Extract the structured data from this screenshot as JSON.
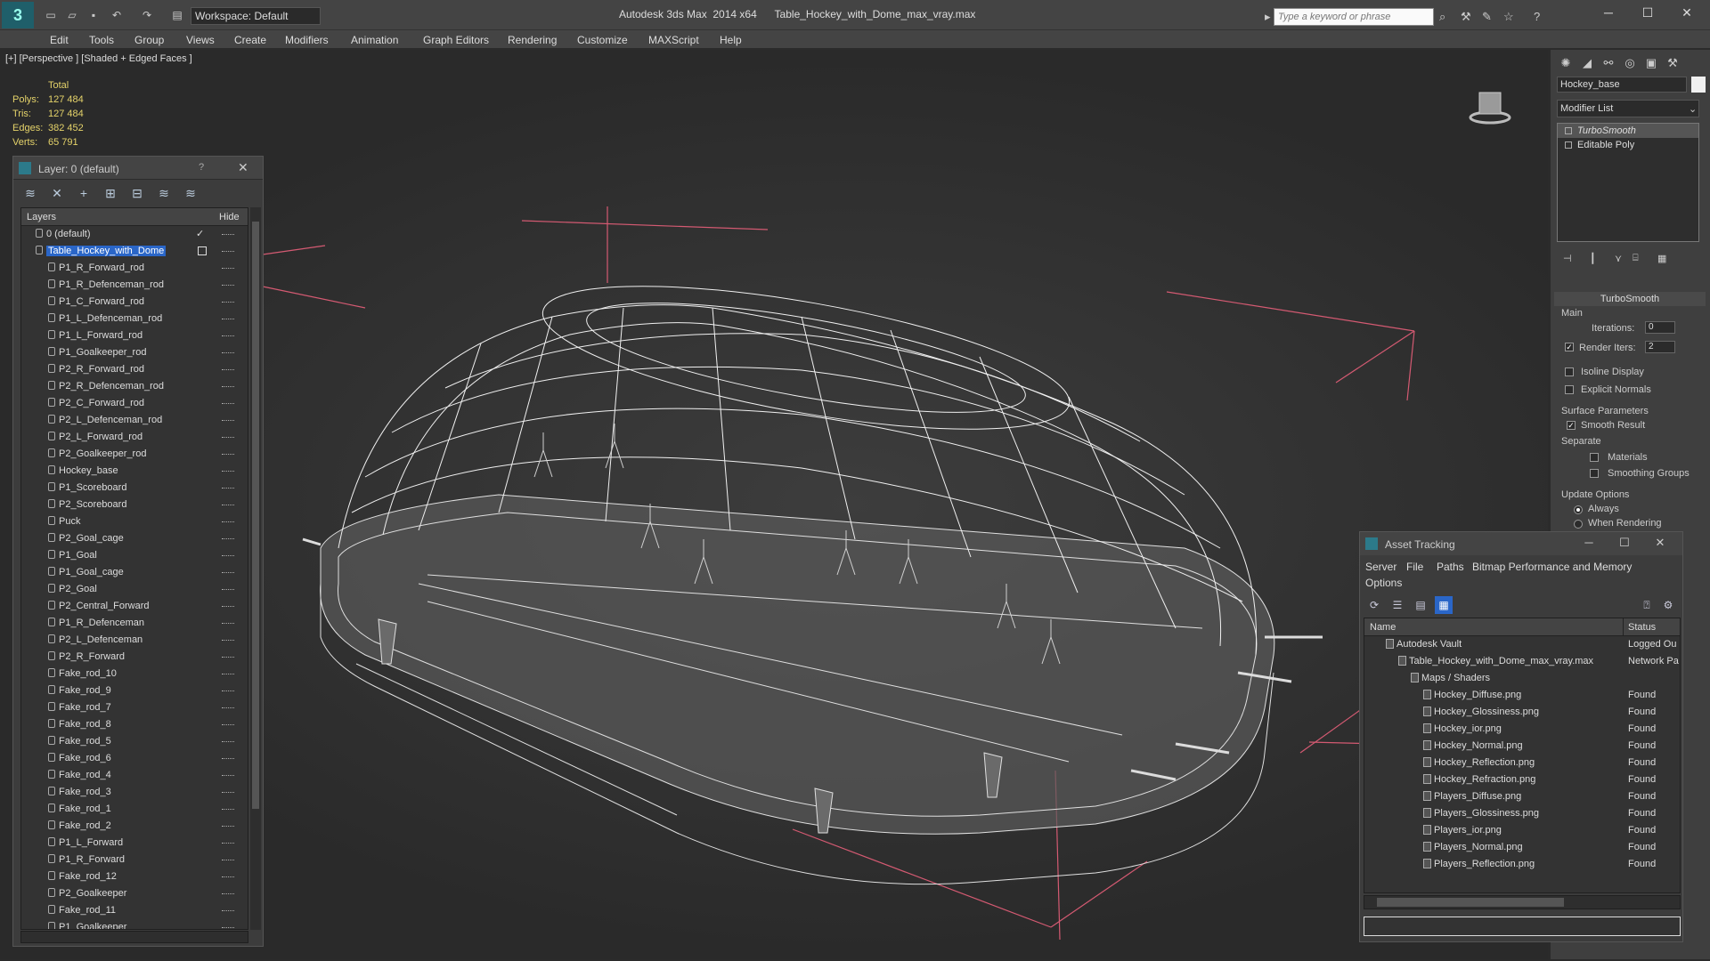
{
  "app": {
    "title": "Autodesk 3ds Max  2014 x64      Table_Hockey_with_Dome_max_vray.max",
    "logo": "3ds-max-logo",
    "workspace": "Workspace: Default",
    "search_placeholder": "Type a keyword or phrase"
  },
  "menu": [
    "Edit",
    "Tools",
    "Group",
    "Views",
    "Create",
    "Modifiers",
    "Animation",
    "Graph Editors",
    "Rendering",
    "Customize",
    "MAXScript",
    "Help"
  ],
  "viewport": {
    "label": "[+] [Perspective ] [Shaded + Edged Faces ]",
    "stats": {
      "header": "Total",
      "rows": [
        {
          "label": "Polys:",
          "value": "127 484"
        },
        {
          "label": "Tris:",
          "value": "127 484"
        },
        {
          "label": "Edges:",
          "value": "382 452"
        },
        {
          "label": "Verts:",
          "value": "65 791"
        }
      ]
    }
  },
  "layer_panel": {
    "title": "Layer: 0 (default)",
    "help": "?",
    "col_layers": "Layers",
    "col_hide": "Hide",
    "items": [
      {
        "name": "0 (default)",
        "level": 0,
        "selected": false
      },
      {
        "name": "Table_Hockey_with_Dome",
        "level": 0,
        "selected": true
      },
      {
        "name": "P1_R_Forward_rod",
        "level": 1
      },
      {
        "name": "P1_R_Defenceman_rod",
        "level": 1
      },
      {
        "name": "P1_C_Forward_rod",
        "level": 1
      },
      {
        "name": "P1_L_Defenceman_rod",
        "level": 1
      },
      {
        "name": "P1_L_Forward_rod",
        "level": 1
      },
      {
        "name": "P1_Goalkeeper_rod",
        "level": 1
      },
      {
        "name": "P2_R_Forward_rod",
        "level": 1
      },
      {
        "name": "P2_R_Defenceman_rod",
        "level": 1
      },
      {
        "name": "P2_C_Forward_rod",
        "level": 1
      },
      {
        "name": "P2_L_Defenceman_rod",
        "level": 1
      },
      {
        "name": "P2_L_Forward_rod",
        "level": 1
      },
      {
        "name": "P2_Goalkeeper_rod",
        "level": 1
      },
      {
        "name": "Hockey_base",
        "level": 1
      },
      {
        "name": "P1_Scoreboard",
        "level": 1
      },
      {
        "name": "P2_Scoreboard",
        "level": 1
      },
      {
        "name": "Puck",
        "level": 1
      },
      {
        "name": "P2_Goal_cage",
        "level": 1
      },
      {
        "name": "P1_Goal",
        "level": 1
      },
      {
        "name": "P1_Goal_cage",
        "level": 1
      },
      {
        "name": "P2_Goal",
        "level": 1
      },
      {
        "name": "P2_Central_Forward",
        "level": 1
      },
      {
        "name": "P1_R_Defenceman",
        "level": 1
      },
      {
        "name": "P2_L_Defenceman",
        "level": 1
      },
      {
        "name": "P2_R_Forward",
        "level": 1
      },
      {
        "name": "Fake_rod_10",
        "level": 1
      },
      {
        "name": "Fake_rod_9",
        "level": 1
      },
      {
        "name": "Fake_rod_7",
        "level": 1
      },
      {
        "name": "Fake_rod_8",
        "level": 1
      },
      {
        "name": "Fake_rod_5",
        "level": 1
      },
      {
        "name": "Fake_rod_6",
        "level": 1
      },
      {
        "name": "Fake_rod_4",
        "level": 1
      },
      {
        "name": "Fake_rod_3",
        "level": 1
      },
      {
        "name": "Fake_rod_1",
        "level": 1
      },
      {
        "name": "Fake_rod_2",
        "level": 1
      },
      {
        "name": "P1_L_Forward",
        "level": 1
      },
      {
        "name": "P1_R_Forward",
        "level": 1
      },
      {
        "name": "Fake_rod_12",
        "level": 1
      },
      {
        "name": "P2_Goalkeeper",
        "level": 1
      },
      {
        "name": "Fake_rod_11",
        "level": 1
      },
      {
        "name": "P1_Goalkeeper",
        "level": 1
      }
    ]
  },
  "command_panel": {
    "object_name": "Hockey_base",
    "modifier_list": "Modifier List",
    "stack": [
      {
        "name": "TurboSmooth",
        "selected": true
      },
      {
        "name": "Editable Poly",
        "selected": false
      }
    ],
    "turbosmooth": {
      "title": "TurboSmooth",
      "main": "Main",
      "iterations_label": "Iterations:",
      "iterations_value": "0",
      "render_iters_label": "Render Iters:",
      "render_iters_value": "2",
      "isoline": "Isoline Display",
      "explicit_normals": "Explicit Normals",
      "surface_params": "Surface Parameters",
      "smooth_result": "Smooth Result",
      "separate": "Separate",
      "materials": "Materials",
      "smoothing_groups": "Smoothing Groups",
      "update_options": "Update Options",
      "always": "Always",
      "when_rendering": "When Rendering"
    }
  },
  "asset_tracking": {
    "title": "Asset Tracking",
    "menu": [
      "Server",
      "File",
      "Paths",
      "Bitmap Performance and Memory",
      "Options"
    ],
    "col_name": "Name",
    "col_status": "Status",
    "rows": [
      {
        "name": "Autodesk Vault",
        "status": "Logged Ou",
        "level": 0
      },
      {
        "name": "Table_Hockey_with_Dome_max_vray.max",
        "status": "Network Pa",
        "level": 1
      },
      {
        "name": "Maps / Shaders",
        "status": "",
        "level": 2
      },
      {
        "name": "Hockey_Diffuse.png",
        "status": "Found",
        "level": 3
      },
      {
        "name": "Hockey_Glossiness.png",
        "status": "Found",
        "level": 3
      },
      {
        "name": "Hockey_ior.png",
        "status": "Found",
        "level": 3
      },
      {
        "name": "Hockey_Normal.png",
        "status": "Found",
        "level": 3
      },
      {
        "name": "Hockey_Reflection.png",
        "status": "Found",
        "level": 3
      },
      {
        "name": "Hockey_Refraction.png",
        "status": "Found",
        "level": 3
      },
      {
        "name": "Players_Diffuse.png",
        "status": "Found",
        "level": 3
      },
      {
        "name": "Players_Glossiness.png",
        "status": "Found",
        "level": 3
      },
      {
        "name": "Players_ior.png",
        "status": "Found",
        "level": 3
      },
      {
        "name": "Players_Normal.png",
        "status": "Found",
        "level": 3
      },
      {
        "name": "Players_Reflection.png",
        "status": "Found",
        "level": 3
      }
    ]
  },
  "colors": {
    "stats_text": "#e5d36a",
    "selection": "#2a66c8",
    "bbox_lines": "#d45a72",
    "wireframe": "#e8e8e8"
  }
}
